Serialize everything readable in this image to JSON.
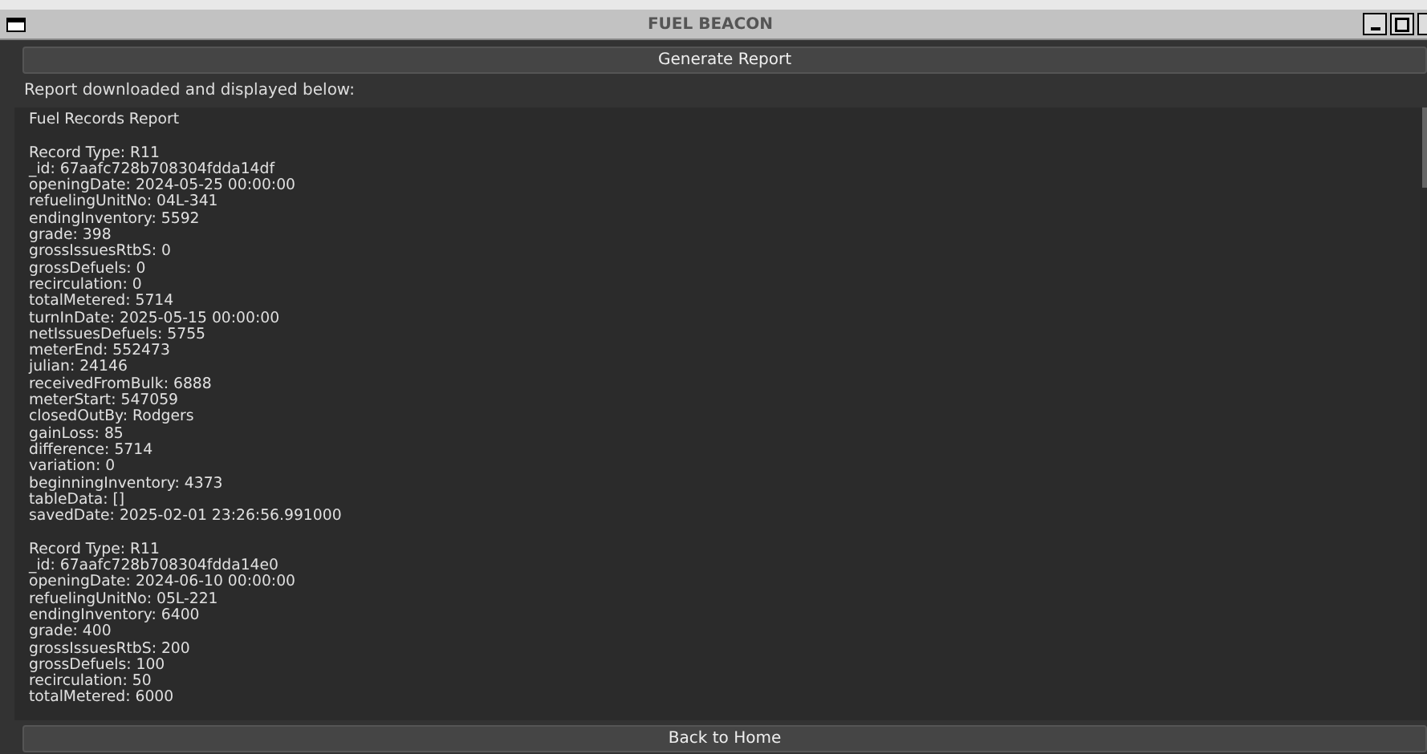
{
  "window": {
    "title": "FUEL BEACON"
  },
  "generate_button": "Generate Report",
  "status": "Report downloaded and displayed below:",
  "report": {
    "title": "Fuel Records Report",
    "records": [
      {
        "lines": [
          "Record Type: R11",
          "_id: 67aafc728b708304fdda14df",
          "openingDate: 2024-05-25 00:00:00",
          "refuelingUnitNo: 04L-341",
          "endingInventory: 5592",
          "grade: 398",
          "grossIssuesRtbS: 0",
          "grossDefuels: 0",
          "recirculation: 0",
          "totalMetered: 5714",
          "turnInDate: 2025-05-15 00:00:00",
          "netIssuesDefuels: 5755",
          "meterEnd: 552473",
          "julian: 24146",
          "receivedFromBulk: 6888",
          "meterStart: 547059",
          "closedOutBy: Rodgers",
          "gainLoss: 85",
          "difference: 5714",
          "variation: 0",
          "beginningInventory: 4373",
          "tableData: []",
          "savedDate: 2025-02-01 23:26:56.991000"
        ]
      },
      {
        "lines": [
          "Record Type: R11",
          "_id: 67aafc728b708304fdda14e0",
          "openingDate: 2024-06-10 00:00:00",
          "refuelingUnitNo: 05L-221",
          "endingInventory: 6400",
          "grade: 400",
          "grossIssuesRtbS: 200",
          "grossDefuels: 100",
          "recirculation: 50",
          "totalMetered: 6000"
        ]
      }
    ]
  },
  "back_button": "Back to Home"
}
